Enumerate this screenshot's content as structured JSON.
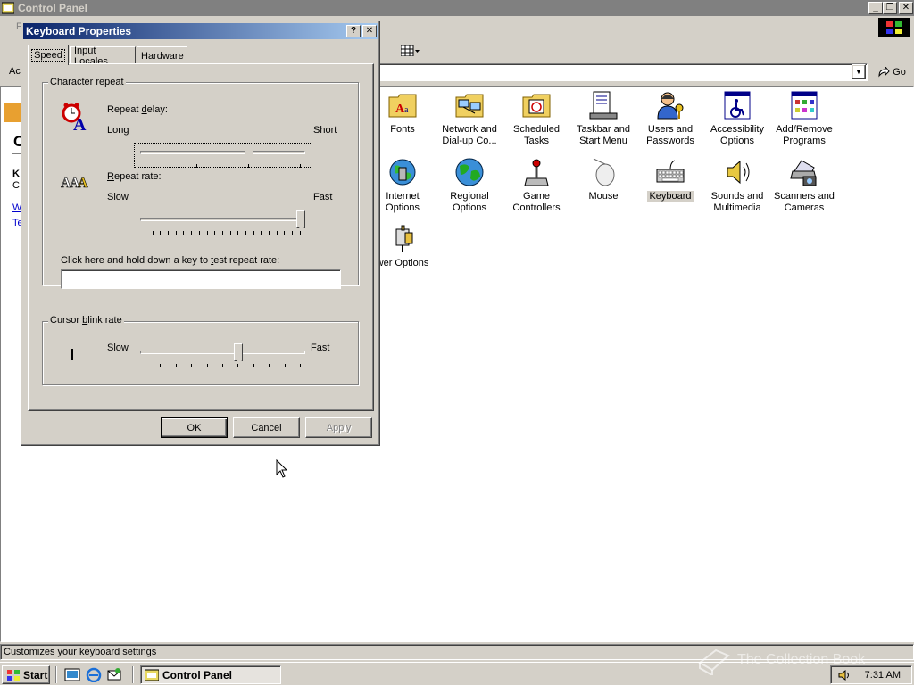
{
  "window": {
    "title": "Control Panel",
    "buttons": {
      "minimize": "_",
      "restore": "❐",
      "close": "✕"
    }
  },
  "menubar": {
    "first_letter": "F"
  },
  "address": {
    "label": "Ac",
    "go_label": "Go"
  },
  "left_pane": {
    "title_letter": "C",
    "heading_letter": "K",
    "sub_letter": "C",
    "link1": "W",
    "link2": "Te"
  },
  "icons": [
    {
      "label": "Fonts",
      "icon": "fonts-folder-icon"
    },
    {
      "label": "Network and Dial-up Co...",
      "icon": "network-folder-icon"
    },
    {
      "label": "Scheduled Tasks",
      "icon": "scheduled-tasks-folder-icon"
    },
    {
      "label": "Taskbar and Start Menu",
      "icon": "taskbar-icon"
    },
    {
      "label": "Users and Passwords",
      "icon": "users-key-icon"
    },
    {
      "label": "Accessibility Options",
      "icon": "accessibility-icon"
    },
    {
      "label": "Add/Remove Programs",
      "icon": "add-remove-programs-icon"
    },
    {
      "label": "Internet Options",
      "icon": "internet-globe-icon"
    },
    {
      "label": "Regional Options",
      "icon": "regional-globe-icon"
    },
    {
      "label": "Game Controllers",
      "icon": "joystick-icon"
    },
    {
      "label": "Mouse",
      "icon": "mouse-icon"
    },
    {
      "label": "Keyboard",
      "icon": "keyboard-icon",
      "selected": true
    },
    {
      "label": "Sounds and Multimedia",
      "icon": "speaker-icon"
    },
    {
      "label": "Scanners and Cameras",
      "icon": "scanner-icon"
    },
    {
      "label": "wer Options",
      "icon": "power-plug-icon"
    }
  ],
  "status_bar": {
    "text": "Customizes your keyboard settings"
  },
  "taskbar": {
    "start_label": "Start",
    "task_label": "Control Panel",
    "clock": "7:31 AM",
    "watermark": "The Collection Book"
  },
  "dialog": {
    "title": "Keyboard Properties",
    "help_button": "?",
    "close_button": "✕",
    "tabs": [
      "Speed",
      "Input Locales",
      "Hardware"
    ],
    "active_tab": "Speed",
    "character_repeat": {
      "legend": "Character repeat",
      "repeat_delay": {
        "label_pre": "Repeat ",
        "label_accel": "d",
        "label_post": "elay:",
        "min_label": "Long",
        "max_label": "Short",
        "value": 2,
        "max": 3
      },
      "repeat_rate": {
        "label_accel": "R",
        "label_post": "epeat rate:",
        "min_label": "Slow",
        "max_label": "Fast",
        "value": 20,
        "max": 20
      },
      "test_label_pre": "Click here and hold down a key to ",
      "test_label_accel": "t",
      "test_label_post": "est repeat rate:",
      "test_value": ""
    },
    "cursor_blink": {
      "legend_pre": "Cursor ",
      "legend_accel": "b",
      "legend_post": "link rate",
      "min_label": "Slow",
      "max_label": "Fast",
      "value": 6,
      "max": 10
    },
    "buttons": {
      "ok": "OK",
      "cancel": "Cancel",
      "apply": "Apply"
    }
  }
}
